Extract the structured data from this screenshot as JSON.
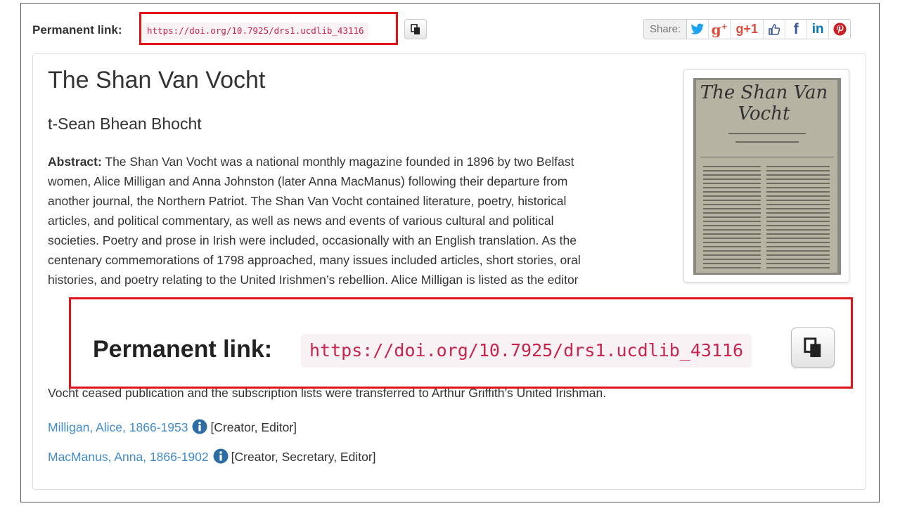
{
  "permalink": {
    "label": "Permanent link:",
    "url": "https://doi.org/10.7925/drs1.ucdlib_43116",
    "copy_icon": "copy-icon"
  },
  "share": {
    "label": "Share:",
    "buttons": [
      {
        "name": "twitter",
        "glyph": "🐦",
        "color": "#1da1f2"
      },
      {
        "name": "google-plus",
        "glyph": "g+",
        "color": "#dd4b39"
      },
      {
        "name": "google-plus-one",
        "glyph": "+1",
        "color": "#dd4b39"
      },
      {
        "name": "like",
        "glyph": "👍",
        "color": "#3b5998"
      },
      {
        "name": "facebook",
        "glyph": "f",
        "color": "#3b5998"
      },
      {
        "name": "linkedin",
        "glyph": "in",
        "color": "#0077b5"
      },
      {
        "name": "pinterest",
        "glyph": "P",
        "color": "#cb2027"
      }
    ]
  },
  "record": {
    "title": "The Shan Van Vocht",
    "subtitle": "t-Sean Bhean Bhocht",
    "abstract_label": "Abstract:",
    "abstract_lines_narrow": [
      " The Shan Van Vocht was a national monthly magazine founded in 1896 by two Belfast",
      "women, Alice Milligan and Anna Johnston (later Anna MacManus) following their departure from",
      "another journal, the Northern Patriot. The Shan Van Vocht contained literature, poetry, historical",
      "articles, and political commentary, as well as news and events of various cultural and political",
      "societies. Poetry and prose in Irish were included, occasionally with an English translation. As the",
      "centenary commemorations of 1798 approached, many issues included articles, short stories, oral",
      "histories, and poetry relating to the United Irishmen’s rebellion. Alice Milligan is listed as the editor"
    ],
    "abstract_last_line": "Vocht ceased publication and the subscription lists were transferred to Arthur Griffith’s United Irishman.",
    "thumbnail_masthead": "The Shan Van Vocht"
  },
  "creators": [
    {
      "name": "Milligan, Alice, 1866-1953",
      "roles": "[Creator, Editor]"
    },
    {
      "name": "MacManus, Anna, 1866-1902",
      "roles": "[Creator, Secretary, Editor]"
    }
  ],
  "colors": {
    "highlight": "#e0131b",
    "link": "#428bca",
    "code": "#c7254e"
  }
}
